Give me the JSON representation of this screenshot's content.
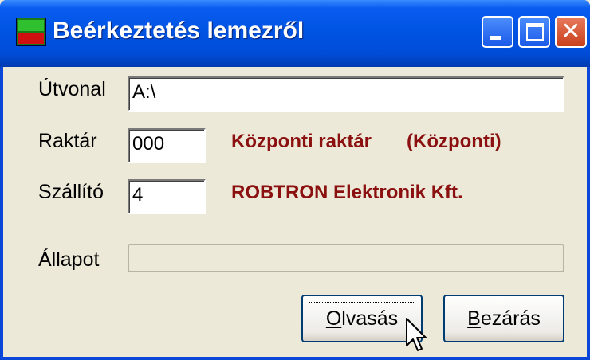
{
  "window": {
    "title": "Beérkeztetés lemezről",
    "icon": "app-icon"
  },
  "form": {
    "utvonal": {
      "label": "Útvonal",
      "value": "A:\\"
    },
    "raktar": {
      "label": "Raktár",
      "value": "000",
      "name": "Központi raktár",
      "extra": "(Központi)"
    },
    "szallito": {
      "label": "Szállító",
      "value": "4",
      "name": "ROBTRON Elektronik Kft."
    },
    "allapot": {
      "label": "Állapot",
      "progress": 0
    }
  },
  "buttons": {
    "read": {
      "mnemonic": "O",
      "rest": "lvasás"
    },
    "close": {
      "mnemonic": "B",
      "rest": "ezárás"
    }
  },
  "colors": {
    "titlebar": "#0054e3",
    "accent_text": "#8b1010",
    "face": "#ece9d8"
  }
}
